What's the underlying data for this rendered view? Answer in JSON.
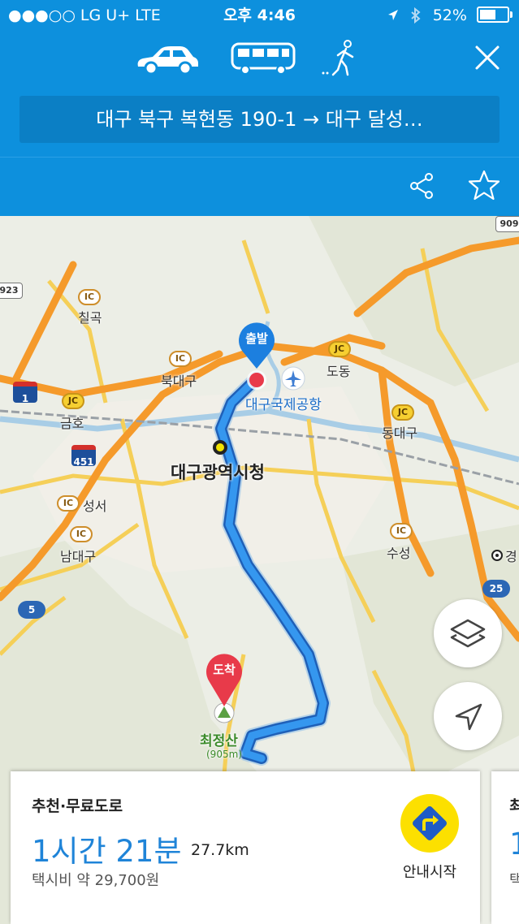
{
  "status_bar": {
    "carrier": "●●●○○ LG U+  LTE",
    "time": "오후 4:46",
    "battery": "52%",
    "battery_level": 0.52
  },
  "header": {
    "modes": [
      {
        "name": "car",
        "icon": "car-icon"
      },
      {
        "name": "bus",
        "icon": "bus-icon"
      },
      {
        "name": "walk",
        "icon": "walking-icon"
      }
    ],
    "close_icon": "close-icon",
    "route_text": "대구 북구 복현동 190-1 → 대구 달성…",
    "share_icon": "share-icon",
    "favorite_icon": "star-icon"
  },
  "map": {
    "origin_marker": "출발",
    "destination_marker": "도착",
    "labels": {
      "airport": "대구국제공항",
      "city_hall": "대구광역시청",
      "peak": "최정산",
      "peak_height": "(905m)",
      "chilgok": "칠곡",
      "bukdaegu": "북대구",
      "geumho": "금호",
      "dongdaegu": "동대구",
      "dodong": "도동",
      "seongseo": "성서",
      "namdaegu": "남대구",
      "suseong": "수성",
      "gyeong": "경"
    },
    "badges": {
      "ic": "IC",
      "jc": "JC"
    },
    "routes": {
      "r923": "923",
      "r909": "909",
      "r1": "1",
      "r451": "451",
      "r5": "5",
      "r25": "25"
    },
    "layers_icon": "layers-icon",
    "locate_icon": "location-arrow-icon"
  },
  "route_card": {
    "type": "추천·무료도로",
    "duration": "1시간 21분",
    "distance": "27.7km",
    "fare": "택시비 약 29,700원",
    "start_label": "안내시작"
  },
  "route_card_next": {
    "type": "최",
    "duration": "1",
    "fare": "택"
  },
  "colors": {
    "header": "#0d90dd",
    "route": "#2f8fe6",
    "start_button": "#fce000"
  }
}
